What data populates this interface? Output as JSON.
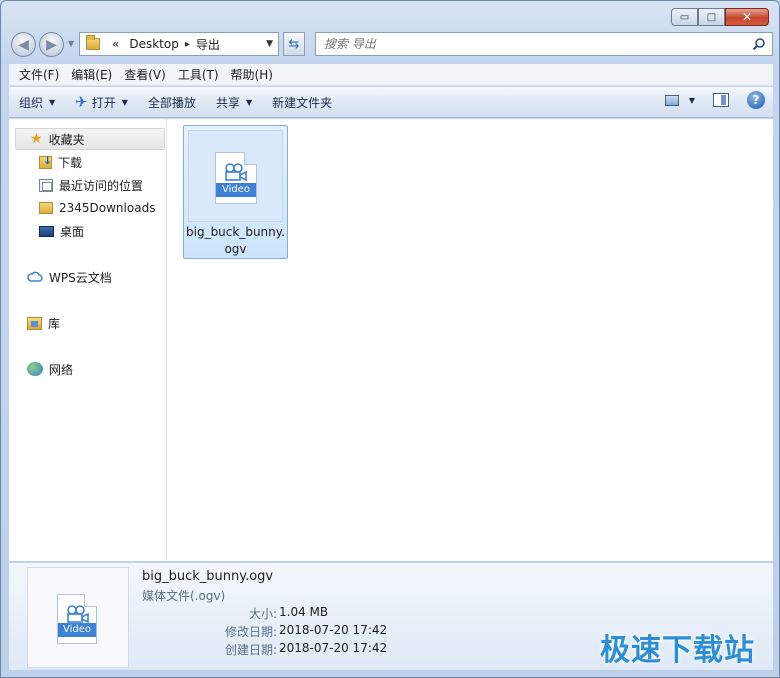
{
  "window": {
    "caption": {
      "min": "▭",
      "max": "□",
      "close": "✕"
    }
  },
  "address": {
    "prefix": "«",
    "crumbs": [
      "Desktop",
      "导出"
    ],
    "separator": "▸"
  },
  "search": {
    "placeholder": "搜索 导出"
  },
  "menu": [
    "文件(F)",
    "编辑(E)",
    "查看(V)",
    "工具(T)",
    "帮助(H)"
  ],
  "toolbar": {
    "organize": "组织",
    "open": "打开",
    "play_all": "全部播放",
    "share": "共享",
    "new_folder": "新建文件夹"
  },
  "nav": {
    "favorites": "收藏夹",
    "downloads": "下载",
    "recent": "最近访问的位置",
    "downloads2345": "2345Downloads",
    "desktop": "桌面",
    "wps": "WPS云文档",
    "library": "库",
    "network": "网络"
  },
  "file": {
    "badge": "Video",
    "name": "big_buck_bunny.ogv"
  },
  "details": {
    "badge": "Video",
    "name": "big_buck_bunny.ogv",
    "type": "媒体文件(.ogv)",
    "size_key": "大小:",
    "size_val": "1.04 MB",
    "modified_key": "修改日期:",
    "modified_val": "2018-07-20 17:42",
    "created_key": "创建日期:",
    "created_val": "2018-07-20 17:42"
  },
  "watermark": "极速下载站",
  "colors": {
    "accent": "#3d82d6",
    "selection": "#cde4fb",
    "watermark": "#2c8fd6"
  }
}
